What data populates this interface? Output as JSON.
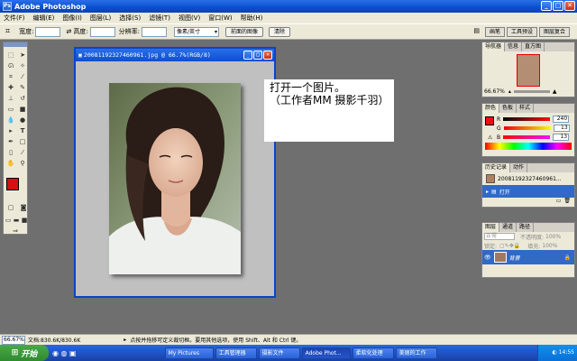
{
  "window": {
    "title": "Adobe Photoshop",
    "app_icon": "Ps"
  },
  "menu": [
    "文件(F)",
    "编辑(E)",
    "图像(I)",
    "图层(L)",
    "选择(S)",
    "滤镜(T)",
    "视图(V)",
    "窗口(W)",
    "帮助(H)"
  ],
  "options_bar": {
    "width_label": "宽度:",
    "height_label": "高度:",
    "resolution_label": "分辨率:",
    "unit_select": "像素/英寸",
    "front_image_button": "前面的图像",
    "clear_button": "清除",
    "palette_tabs": [
      "画笔",
      "工具预设",
      "图层复合"
    ]
  },
  "document": {
    "title": "20081192327460961.jpg @ 66.7%(RGB/8)",
    "min_glyph": "_",
    "max_glyph": "□",
    "close_glyph": "✕"
  },
  "note": {
    "line1": "打开一个图片。",
    "line2": "（工作者MM 摄影千羽）"
  },
  "panels": {
    "navigator": {
      "tabs": [
        "导航器",
        "信息",
        "直方图"
      ],
      "zoom": "66.67%"
    },
    "color": {
      "tabs": [
        "颜色",
        "色板",
        "样式"
      ],
      "r_label": "R",
      "r_value": "240",
      "g_label": "G",
      "g_value": "13",
      "b_label": "B",
      "b_value": "13",
      "fg_color": "#f00d0d"
    },
    "history": {
      "tabs": [
        "历史记录",
        "动作"
      ],
      "snapshot": "20081192327460961...",
      "step": "打开"
    },
    "layers": {
      "tabs": [
        "图层",
        "通道",
        "路径"
      ],
      "blend_mode": "正常",
      "opacity_label": "不透明度:",
      "opacity_value": "100%",
      "lock_label": "锁定:",
      "fill_label": "填充:",
      "fill_value": "100%",
      "layer_name": "背景"
    }
  },
  "status": {
    "zoom": "66.67%",
    "doc_info": "文档:830.6K/830.6K",
    "hint": "点按并拖移可定义裁切框。要用其他选项，使用 Shift、Alt 和 Ctrl 键。"
  },
  "taskbar": {
    "start": "开始",
    "tasks": [
      "My Pictures",
      "工具管理器",
      "摄影文件",
      "Adobe Phot...",
      "柔软化处理",
      "美丽的工作"
    ],
    "active_task": 3,
    "clock": "14:55"
  }
}
